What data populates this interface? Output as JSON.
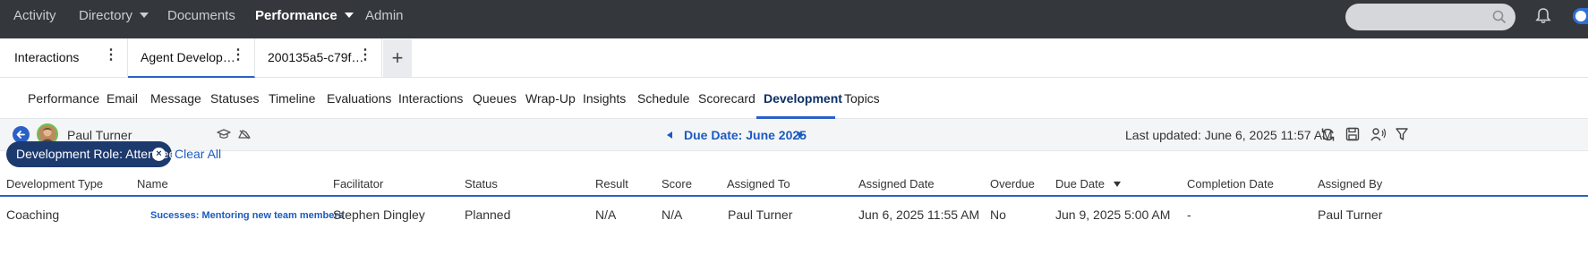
{
  "topnav": {
    "items": [
      "Activity",
      "Directory",
      "Documents",
      "Performance",
      "Admin"
    ],
    "active": "Performance"
  },
  "tabs": [
    {
      "label": "Interactions"
    },
    {
      "label": "Agent Develop…"
    },
    {
      "label": "200135a5-c79f…"
    }
  ],
  "tab_add": "+",
  "subtabs": [
    "Performance",
    "Email",
    "Message",
    "Statuses",
    "Timeline",
    "Evaluations",
    "Interactions",
    "Queues",
    "Wrap-Up",
    "Insights",
    "Schedule",
    "Scorecard",
    "Development",
    "Topics"
  ],
  "subtab_active": "Development",
  "toolbar": {
    "user_name": "Paul Turner",
    "due_date": "Due Date: June 2025",
    "last_updated": "Last updated: June 6, 2025 11:57 AM"
  },
  "filters": {
    "chip_label": "Development Role: Attendee",
    "clear_all": "Clear All"
  },
  "table": {
    "headers": [
      "Development Type",
      "Name",
      "Facilitator",
      "Status",
      "Result",
      "Score",
      "Assigned To",
      "Assigned Date",
      "Overdue",
      "Due Date",
      "Completion Date",
      "Assigned By"
    ],
    "sorted_column": "Due Date",
    "rows": [
      [
        "Coaching",
        "Sucesses: Mentoring new team members",
        "Stephen Dingley",
        "Planned",
        "N/A",
        "N/A",
        "Paul Turner",
        "Jun 6, 2025 11:55 AM",
        "No",
        "Jun 9, 2025 5:00 AM",
        "-",
        "Paul Turner"
      ]
    ]
  },
  "colors": {
    "nav_bg": "#34383d",
    "accent": "#2a60c8",
    "chip_bg": "#1d3a6e",
    "link": "#1b5bc0"
  }
}
